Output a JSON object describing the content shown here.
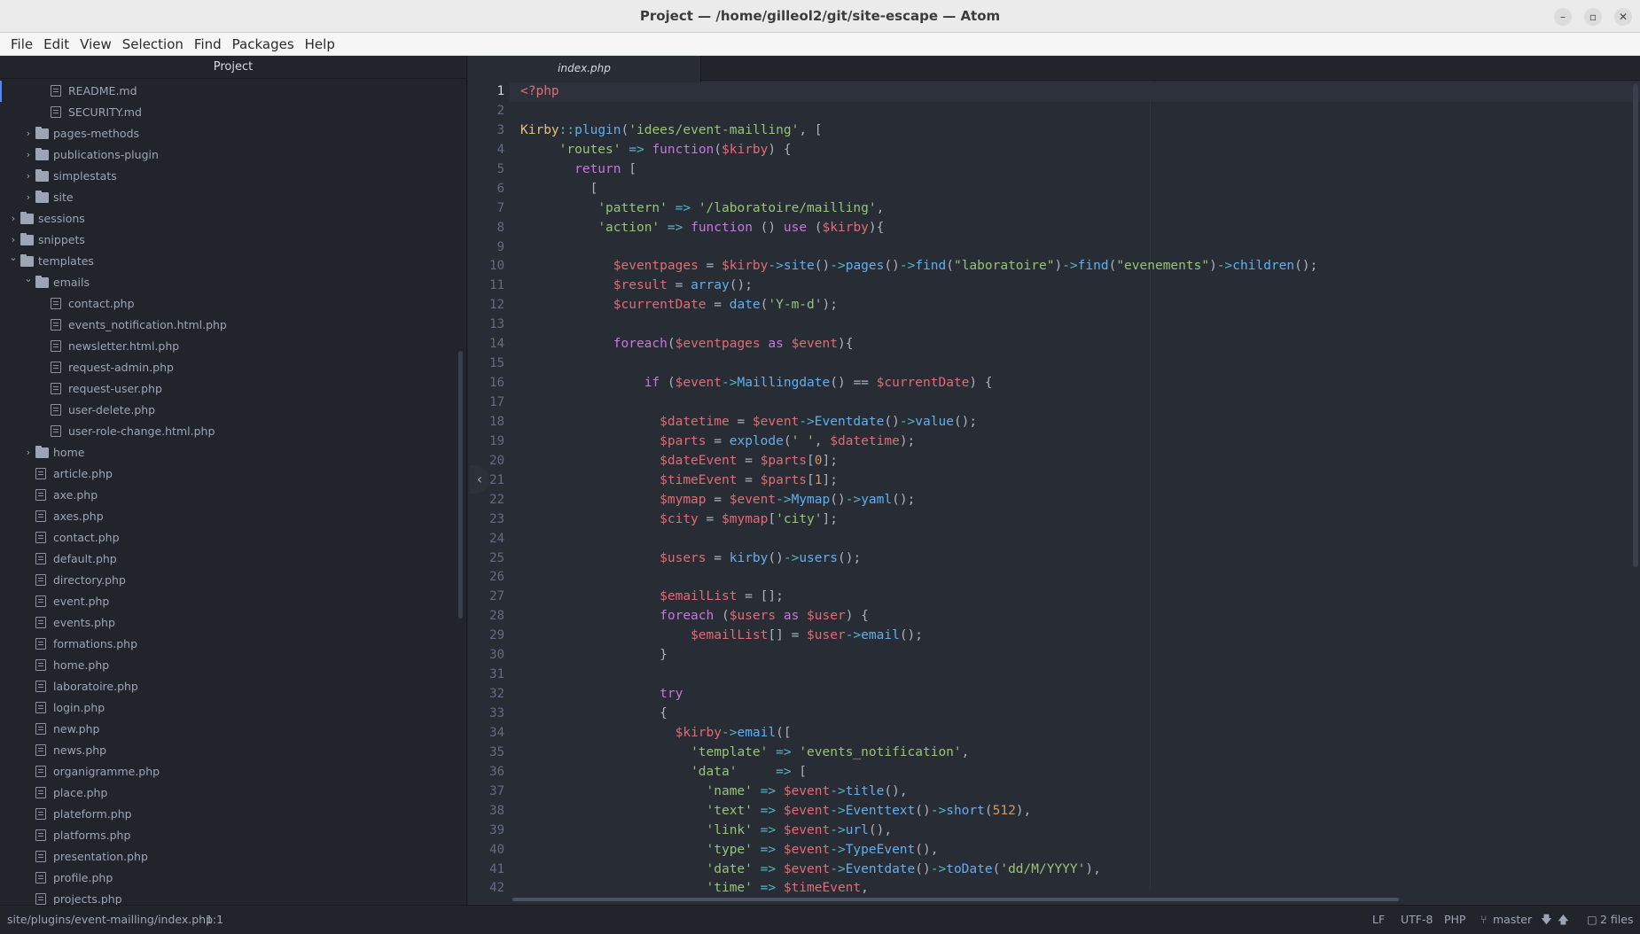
{
  "window": {
    "title": "Project — /home/gilleol2/git/site-escape — Atom",
    "controls": [
      "–",
      "▫",
      "✕"
    ]
  },
  "menu": [
    "File",
    "Edit",
    "View",
    "Selection",
    "Find",
    "Packages",
    "Help"
  ],
  "tree": {
    "header": "Project",
    "items": [
      {
        "label": "README.md",
        "type": "file",
        "depth": 5
      },
      {
        "label": "SECURITY.md",
        "type": "file",
        "depth": 5
      },
      {
        "label": "pages-methods",
        "type": "folder",
        "depth": 4,
        "open": false
      },
      {
        "label": "publications-plugin",
        "type": "folder",
        "depth": 4,
        "open": false
      },
      {
        "label": "simplestats",
        "type": "folder",
        "depth": 4,
        "open": false
      },
      {
        "label": "site",
        "type": "folder",
        "depth": 4,
        "open": false
      },
      {
        "label": "sessions",
        "type": "folder",
        "depth": 3,
        "open": false
      },
      {
        "label": "snippets",
        "type": "folder",
        "depth": 3,
        "open": false
      },
      {
        "label": "templates",
        "type": "folder",
        "depth": 3,
        "open": true
      },
      {
        "label": "emails",
        "type": "folder",
        "depth": 4,
        "open": true
      },
      {
        "label": "contact.php",
        "type": "file",
        "depth": 5
      },
      {
        "label": "events_notification.html.php",
        "type": "file",
        "depth": 5
      },
      {
        "label": "newsletter.html.php",
        "type": "file",
        "depth": 5
      },
      {
        "label": "request-admin.php",
        "type": "file",
        "depth": 5
      },
      {
        "label": "request-user.php",
        "type": "file",
        "depth": 5
      },
      {
        "label": "user-delete.php",
        "type": "file",
        "depth": 5
      },
      {
        "label": "user-role-change.html.php",
        "type": "file",
        "depth": 5
      },
      {
        "label": "home",
        "type": "folder",
        "depth": 4,
        "open": false
      },
      {
        "label": "article.php",
        "type": "file",
        "depth": 4
      },
      {
        "label": "axe.php",
        "type": "file",
        "depth": 4
      },
      {
        "label": "axes.php",
        "type": "file",
        "depth": 4
      },
      {
        "label": "contact.php",
        "type": "file",
        "depth": 4
      },
      {
        "label": "default.php",
        "type": "file",
        "depth": 4
      },
      {
        "label": "directory.php",
        "type": "file",
        "depth": 4
      },
      {
        "label": "event.php",
        "type": "file",
        "depth": 4
      },
      {
        "label": "events.php",
        "type": "file",
        "depth": 4
      },
      {
        "label": "formations.php",
        "type": "file",
        "depth": 4
      },
      {
        "label": "home.php",
        "type": "file",
        "depth": 4
      },
      {
        "label": "laboratoire.php",
        "type": "file",
        "depth": 4
      },
      {
        "label": "login.php",
        "type": "file",
        "depth": 4
      },
      {
        "label": "new.php",
        "type": "file",
        "depth": 4
      },
      {
        "label": "news.php",
        "type": "file",
        "depth": 4
      },
      {
        "label": "organigramme.php",
        "type": "file",
        "depth": 4
      },
      {
        "label": "place.php",
        "type": "file",
        "depth": 4
      },
      {
        "label": "plateform.php",
        "type": "file",
        "depth": 4
      },
      {
        "label": "platforms.php",
        "type": "file",
        "depth": 4
      },
      {
        "label": "presentation.php",
        "type": "file",
        "depth": 4
      },
      {
        "label": "profile.php",
        "type": "file",
        "depth": 4
      },
      {
        "label": "projects.php",
        "type": "file",
        "depth": 4
      }
    ]
  },
  "editor": {
    "tab": "index.php",
    "lines": [
      [
        [
          "tag",
          "<?php"
        ]
      ],
      [],
      [
        [
          "cls",
          "Kirby"
        ],
        [
          "op",
          "::"
        ],
        [
          "fn",
          "plugin"
        ],
        [
          "p",
          "("
        ],
        [
          "str",
          "'idees/event-mailling'"
        ],
        [
          "p",
          ", ["
        ]
      ],
      [
        [
          "p",
          "     "
        ],
        [
          "str",
          "'routes'"
        ],
        [
          "p",
          " "
        ],
        [
          "op",
          "=>"
        ],
        [
          "p",
          " "
        ],
        [
          "kw",
          "function"
        ],
        [
          "p",
          "("
        ],
        [
          "var",
          "$kirby"
        ],
        [
          "p",
          ") {"
        ]
      ],
      [
        [
          "p",
          "       "
        ],
        [
          "kw",
          "return"
        ],
        [
          "p",
          " ["
        ]
      ],
      [
        [
          "p",
          "         ["
        ]
      ],
      [
        [
          "p",
          "          "
        ],
        [
          "str",
          "'pattern'"
        ],
        [
          "p",
          " "
        ],
        [
          "op",
          "=>"
        ],
        [
          "p",
          " "
        ],
        [
          "str",
          "'/laboratoire/mailling'"
        ],
        [
          "p",
          ","
        ]
      ],
      [
        [
          "p",
          "          "
        ],
        [
          "str",
          "'action'"
        ],
        [
          "p",
          " "
        ],
        [
          "op",
          "=>"
        ],
        [
          "p",
          " "
        ],
        [
          "kw",
          "function"
        ],
        [
          "p",
          " () "
        ],
        [
          "kw",
          "use"
        ],
        [
          "p",
          " ("
        ],
        [
          "var",
          "$kirby"
        ],
        [
          "p",
          "){"
        ]
      ],
      [],
      [
        [
          "p",
          "            "
        ],
        [
          "var",
          "$eventpages"
        ],
        [
          "p",
          " = "
        ],
        [
          "var",
          "$kirby"
        ],
        [
          "op",
          "->"
        ],
        [
          "fn",
          "site"
        ],
        [
          "p",
          "()"
        ],
        [
          "op",
          "->"
        ],
        [
          "fn",
          "pages"
        ],
        [
          "p",
          "()"
        ],
        [
          "op",
          "->"
        ],
        [
          "fn",
          "find"
        ],
        [
          "p",
          "("
        ],
        [
          "str",
          "\"laboratoire\""
        ],
        [
          "p",
          ")"
        ],
        [
          "op",
          "->"
        ],
        [
          "fn",
          "find"
        ],
        [
          "p",
          "("
        ],
        [
          "str",
          "\"evenements\""
        ],
        [
          "p",
          ")"
        ],
        [
          "op",
          "->"
        ],
        [
          "fn",
          "children"
        ],
        [
          "p",
          "();"
        ]
      ],
      [
        [
          "p",
          "            "
        ],
        [
          "var",
          "$result"
        ],
        [
          "p",
          " = "
        ],
        [
          "fn",
          "array"
        ],
        [
          "p",
          "();"
        ]
      ],
      [
        [
          "p",
          "            "
        ],
        [
          "var",
          "$currentDate"
        ],
        [
          "p",
          " = "
        ],
        [
          "fn",
          "date"
        ],
        [
          "p",
          "("
        ],
        [
          "str",
          "'Y-m-d'"
        ],
        [
          "p",
          ");"
        ]
      ],
      [],
      [
        [
          "p",
          "            "
        ],
        [
          "kw",
          "foreach"
        ],
        [
          "p",
          "("
        ],
        [
          "var",
          "$eventpages"
        ],
        [
          "p",
          " "
        ],
        [
          "kw",
          "as"
        ],
        [
          "p",
          " "
        ],
        [
          "var",
          "$event"
        ],
        [
          "p",
          "){"
        ]
      ],
      [],
      [
        [
          "p",
          "                "
        ],
        [
          "kw",
          "if"
        ],
        [
          "p",
          " ("
        ],
        [
          "var",
          "$event"
        ],
        [
          "op",
          "->"
        ],
        [
          "fn",
          "Maillingdate"
        ],
        [
          "p",
          "() == "
        ],
        [
          "var",
          "$currentDate"
        ],
        [
          "p",
          ") {"
        ]
      ],
      [],
      [
        [
          "p",
          "                  "
        ],
        [
          "var",
          "$datetime"
        ],
        [
          "p",
          " = "
        ],
        [
          "var",
          "$event"
        ],
        [
          "op",
          "->"
        ],
        [
          "fn",
          "Eventdate"
        ],
        [
          "p",
          "()"
        ],
        [
          "op",
          "->"
        ],
        [
          "fn",
          "value"
        ],
        [
          "p",
          "();"
        ]
      ],
      [
        [
          "p",
          "                  "
        ],
        [
          "var",
          "$parts"
        ],
        [
          "p",
          " = "
        ],
        [
          "fn",
          "explode"
        ],
        [
          "p",
          "("
        ],
        [
          "str",
          "' '"
        ],
        [
          "p",
          ", "
        ],
        [
          "var",
          "$datetime"
        ],
        [
          "p",
          ");"
        ]
      ],
      [
        [
          "p",
          "                  "
        ],
        [
          "var",
          "$dateEvent"
        ],
        [
          "p",
          " = "
        ],
        [
          "var",
          "$parts"
        ],
        [
          "p",
          "["
        ],
        [
          "num",
          "0"
        ],
        [
          "p",
          "];"
        ]
      ],
      [
        [
          "p",
          "                  "
        ],
        [
          "var",
          "$timeEvent"
        ],
        [
          "p",
          " = "
        ],
        [
          "var",
          "$parts"
        ],
        [
          "p",
          "["
        ],
        [
          "num",
          "1"
        ],
        [
          "p",
          "];"
        ]
      ],
      [
        [
          "p",
          "                  "
        ],
        [
          "var",
          "$mymap"
        ],
        [
          "p",
          " = "
        ],
        [
          "var",
          "$event"
        ],
        [
          "op",
          "->"
        ],
        [
          "fn",
          "Mymap"
        ],
        [
          "p",
          "()"
        ],
        [
          "op",
          "->"
        ],
        [
          "fn",
          "yaml"
        ],
        [
          "p",
          "();"
        ]
      ],
      [
        [
          "p",
          "                  "
        ],
        [
          "var",
          "$city"
        ],
        [
          "p",
          " = "
        ],
        [
          "var",
          "$mymap"
        ],
        [
          "p",
          "["
        ],
        [
          "str",
          "'city'"
        ],
        [
          "p",
          "];"
        ]
      ],
      [],
      [
        [
          "p",
          "                  "
        ],
        [
          "var",
          "$users"
        ],
        [
          "p",
          " = "
        ],
        [
          "fn",
          "kirby"
        ],
        [
          "p",
          "()"
        ],
        [
          "op",
          "->"
        ],
        [
          "fn",
          "users"
        ],
        [
          "p",
          "();"
        ]
      ],
      [],
      [
        [
          "p",
          "                  "
        ],
        [
          "var",
          "$emailList"
        ],
        [
          "p",
          " = [];"
        ]
      ],
      [
        [
          "p",
          "                  "
        ],
        [
          "kw",
          "foreach"
        ],
        [
          "p",
          " ("
        ],
        [
          "var",
          "$users"
        ],
        [
          "p",
          " "
        ],
        [
          "kw",
          "as"
        ],
        [
          "p",
          " "
        ],
        [
          "var",
          "$user"
        ],
        [
          "p",
          ") {"
        ]
      ],
      [
        [
          "p",
          "                      "
        ],
        [
          "var",
          "$emailList"
        ],
        [
          "p",
          "[] = "
        ],
        [
          "var",
          "$user"
        ],
        [
          "op",
          "->"
        ],
        [
          "fn",
          "email"
        ],
        [
          "p",
          "();"
        ]
      ],
      [
        [
          "p",
          "                  }"
        ]
      ],
      [],
      [
        [
          "p",
          "                  "
        ],
        [
          "kw",
          "try"
        ]
      ],
      [
        [
          "p",
          "                  {"
        ]
      ],
      [
        [
          "p",
          "                    "
        ],
        [
          "var",
          "$kirby"
        ],
        [
          "op",
          "->"
        ],
        [
          "fn",
          "email"
        ],
        [
          "p",
          "(["
        ]
      ],
      [
        [
          "p",
          "                      "
        ],
        [
          "str",
          "'template'"
        ],
        [
          "p",
          " "
        ],
        [
          "op",
          "=>"
        ],
        [
          "p",
          " "
        ],
        [
          "str",
          "'events_notification'"
        ],
        [
          "p",
          ","
        ]
      ],
      [
        [
          "p",
          "                      "
        ],
        [
          "str",
          "'data'"
        ],
        [
          "p",
          "     "
        ],
        [
          "op",
          "=>"
        ],
        [
          "p",
          " ["
        ]
      ],
      [
        [
          "p",
          "                        "
        ],
        [
          "str",
          "'name'"
        ],
        [
          "p",
          " "
        ],
        [
          "op",
          "=>"
        ],
        [
          "p",
          " "
        ],
        [
          "var",
          "$event"
        ],
        [
          "op",
          "->"
        ],
        [
          "fn",
          "title"
        ],
        [
          "p",
          "(),"
        ]
      ],
      [
        [
          "p",
          "                        "
        ],
        [
          "str",
          "'text'"
        ],
        [
          "p",
          " "
        ],
        [
          "op",
          "=>"
        ],
        [
          "p",
          " "
        ],
        [
          "var",
          "$event"
        ],
        [
          "op",
          "->"
        ],
        [
          "fn",
          "Eventtext"
        ],
        [
          "p",
          "()"
        ],
        [
          "op",
          "->"
        ],
        [
          "fn",
          "short"
        ],
        [
          "p",
          "("
        ],
        [
          "num",
          "512"
        ],
        [
          "p",
          "),"
        ]
      ],
      [
        [
          "p",
          "                        "
        ],
        [
          "str",
          "'link'"
        ],
        [
          "p",
          " "
        ],
        [
          "op",
          "=>"
        ],
        [
          "p",
          " "
        ],
        [
          "var",
          "$event"
        ],
        [
          "op",
          "->"
        ],
        [
          "fn",
          "url"
        ],
        [
          "p",
          "(),"
        ]
      ],
      [
        [
          "p",
          "                        "
        ],
        [
          "str",
          "'type'"
        ],
        [
          "p",
          " "
        ],
        [
          "op",
          "=>"
        ],
        [
          "p",
          " "
        ],
        [
          "var",
          "$event"
        ],
        [
          "op",
          "->"
        ],
        [
          "fn",
          "TypeEvent"
        ],
        [
          "p",
          "(),"
        ]
      ],
      [
        [
          "p",
          "                        "
        ],
        [
          "str",
          "'date'"
        ],
        [
          "p",
          " "
        ],
        [
          "op",
          "=>"
        ],
        [
          "p",
          " "
        ],
        [
          "var",
          "$event"
        ],
        [
          "op",
          "->"
        ],
        [
          "fn",
          "Eventdate"
        ],
        [
          "p",
          "()"
        ],
        [
          "op",
          "->"
        ],
        [
          "fn",
          "toDate"
        ],
        [
          "p",
          "("
        ],
        [
          "str",
          "'dd/M/YYYY'"
        ],
        [
          "p",
          "),"
        ]
      ],
      [
        [
          "p",
          "                        "
        ],
        [
          "str",
          "'time'"
        ],
        [
          "p",
          " "
        ],
        [
          "op",
          "=>"
        ],
        [
          "p",
          " "
        ],
        [
          "var",
          "$timeEvent"
        ],
        [
          "p",
          ","
        ]
      ]
    ]
  },
  "status": {
    "path": "site/plugins/event-mailling/index.php",
    "cursor": "1:1",
    "line_ending": "LF",
    "encoding": "UTF-8",
    "grammar": "PHP",
    "branch": "master",
    "files": "2 files"
  }
}
